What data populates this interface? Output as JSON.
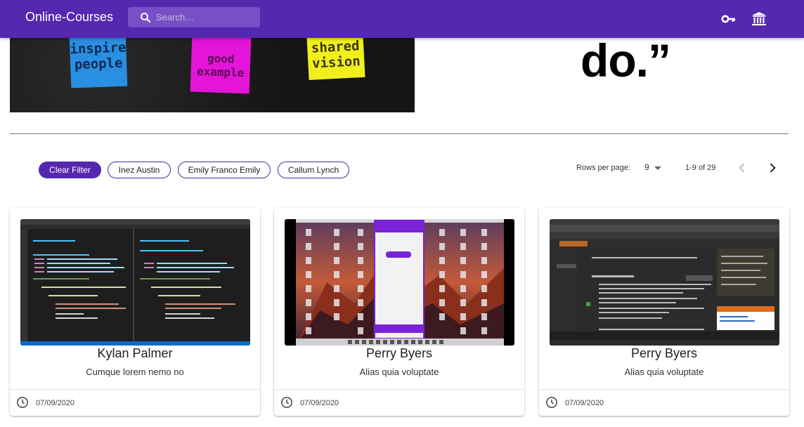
{
  "app": {
    "title": "Online-Courses",
    "search_placeholder": "Search…",
    "icons": [
      "key-icon",
      "institution-icon"
    ],
    "colors": {
      "appbar": "#5528b0",
      "chip_active": "#5528b0"
    }
  },
  "hero": {
    "sticky_notes": [
      {
        "lines": [
          "inspire",
          "people"
        ],
        "color": "#2a8fe0"
      },
      {
        "lines": [
          "good",
          "example"
        ],
        "color": "#e415d8"
      },
      {
        "lines": [
          "shared",
          "vision"
        ],
        "color": "#f2ee1c"
      }
    ],
    "quote_text": "do.”"
  },
  "filters": {
    "chips": [
      {
        "label": "Clear Filter",
        "active": true
      },
      {
        "label": "Inez Austin",
        "active": false
      },
      {
        "label": "Emily Franco Emily",
        "active": false
      },
      {
        "label": "Callum Lynch",
        "active": false
      }
    ]
  },
  "pagination": {
    "rows_label": "Rows per page:",
    "rows_value": "9",
    "range": "1-9 of 29"
  },
  "courses": [
    {
      "name": "Kylan Palmer",
      "description": "Cumque lorem nemo no",
      "date": "07/09/2020",
      "thumbnail": "code-editor-screenshot"
    },
    {
      "name": "Perry Byers",
      "description": "Alias quia voluptate",
      "date": "07/09/2020",
      "thumbnail": "mac-desktop-screenshot"
    },
    {
      "name": "Perry Byers",
      "description": "Alias quia voluptate",
      "date": "07/09/2020",
      "thumbnail": "stackoverflow-screenshot"
    }
  ]
}
